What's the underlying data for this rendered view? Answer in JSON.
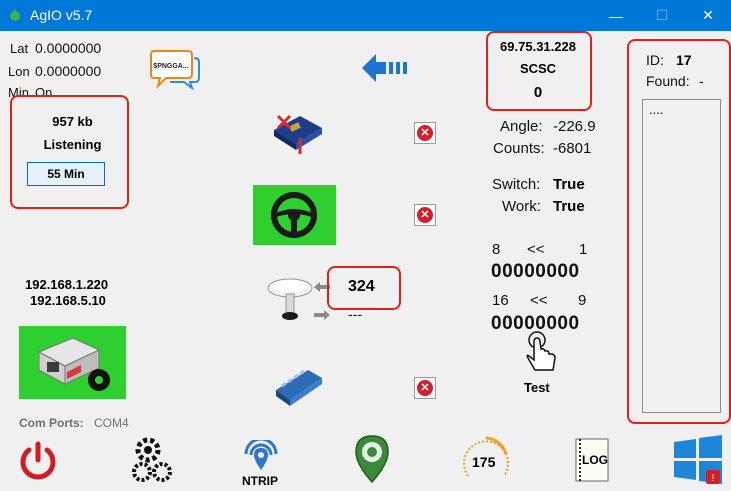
{
  "window": {
    "title": "AgIO v5.7",
    "minimize": "—",
    "maximize": "☐",
    "close": "✕"
  },
  "gps": {
    "lat_label": "Lat",
    "lat_value": "0.0000000",
    "lon_label": "Lon",
    "lon_value": "0.0000000",
    "min_label": "Min",
    "min_value": "On"
  },
  "ntrip_status": {
    "bytes": "957 kb",
    "state": "Listening",
    "minutes_button": "55 Min"
  },
  "ip_addresses": [
    "192.168.1.220",
    "192.168.5.10"
  ],
  "com_ports": {
    "label": "Com Ports:",
    "value": "COM4"
  },
  "nmea_bubble": "$PNGGA...",
  "gps_count": "324",
  "gps_out": "---",
  "remote": {
    "ip": "69.75.31.228",
    "name": "SCSC",
    "value": "0"
  },
  "steer": {
    "angle_label": "Angle:",
    "angle_value": "-226.9",
    "counts_label": "Counts:",
    "counts_value": "-6801",
    "switch_label": "Switch:",
    "switch_value": "True",
    "work_label": "Work:",
    "work_value": "True"
  },
  "bits": {
    "row1_high": "8",
    "row1_arrow": "<<",
    "row1_low": "1",
    "row1_value": "00000000",
    "row2_high": "16",
    "row2_arrow": "<<",
    "row2_low": "9",
    "row2_value": "00000000",
    "test_label": "Test"
  },
  "id_panel": {
    "id_label": "ID:",
    "id_value": "17",
    "found_label": "Found:",
    "found_value": "-",
    "log_text": "...."
  },
  "bottom_toolbar": {
    "ntrip_label": "NTRIP",
    "speed_value": "175",
    "log_label": "LOG"
  },
  "colors": {
    "titlebar": "#0078d7",
    "highlight": "#e0201c",
    "green": "#2ecf2e",
    "arrow_blue": "#1e74d0"
  },
  "icons": [
    "app-icon",
    "nmea-bubble-icon",
    "back-arrow-icon",
    "machine-module-icon",
    "steering-wheel-icon",
    "gps-antenna-icon",
    "relay-board-icon",
    "ethernet-module-icon",
    "power-icon",
    "settings-gears-icon",
    "ntrip-icon",
    "map-pin-icon",
    "speedometer-icon",
    "log-icon",
    "windows-icon",
    "tap-hand-icon",
    "close-x-icon"
  ]
}
